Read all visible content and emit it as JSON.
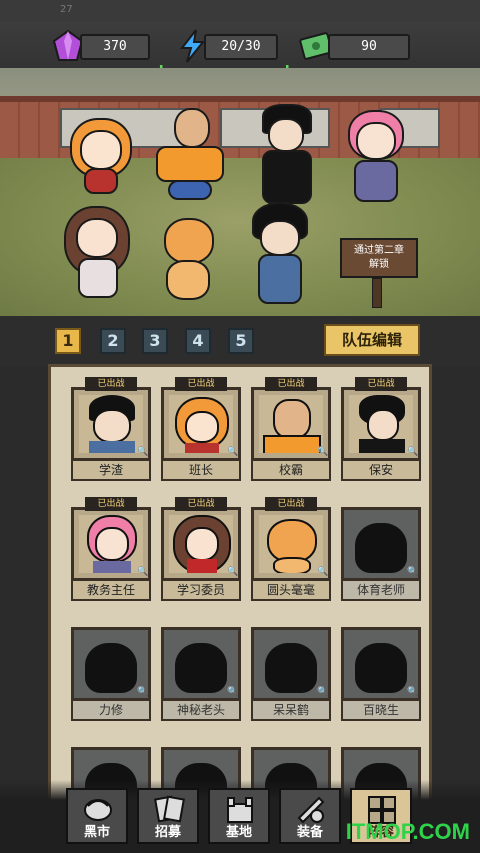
{
  "status": {
    "time": "27"
  },
  "resources": {
    "gems": {
      "value": "370",
      "icon": "gem-icon"
    },
    "energy": {
      "value": "20/30",
      "icon": "lightning-icon"
    },
    "cash": {
      "value": "90",
      "icon": "cash-icon"
    }
  },
  "scene": {
    "sign_text": "通过第二章\n解锁"
  },
  "tabs": [
    "1",
    "2",
    "3",
    "4",
    "5"
  ],
  "active_tab": "1",
  "team_edit_label": "队伍编辑",
  "deployed_badge": "已出战",
  "roster": [
    {
      "name": "学渣",
      "deployed": true
    },
    {
      "name": "班长",
      "deployed": true
    },
    {
      "name": "校霸",
      "deployed": true
    },
    {
      "name": "保安",
      "deployed": true
    },
    {
      "name": "教务主任",
      "deployed": true
    },
    {
      "name": "学习委员",
      "deployed": true
    },
    {
      "name": "圆头毫毫",
      "deployed": true
    },
    {
      "name": "体育老师",
      "deployed": false
    },
    {
      "name": "力修",
      "deployed": false
    },
    {
      "name": "神秘老头",
      "deployed": false
    },
    {
      "name": "呆呆鹤",
      "deployed": false
    },
    {
      "name": "百晓生",
      "deployed": false
    }
  ],
  "nav": [
    {
      "label": "黑市",
      "icon": "market-icon"
    },
    {
      "label": "招募",
      "icon": "recruit-cards-icon"
    },
    {
      "label": "基地",
      "icon": "base-icon"
    },
    {
      "label": "装备",
      "icon": "equipment-icon"
    },
    {
      "label": "阵容",
      "icon": "lineup-icon"
    }
  ],
  "watermark": "ITMOP.COM",
  "colors": {
    "accent": "#e8b94a",
    "tab_inactive": "#3b4b55",
    "plus": "#5fd65f"
  }
}
